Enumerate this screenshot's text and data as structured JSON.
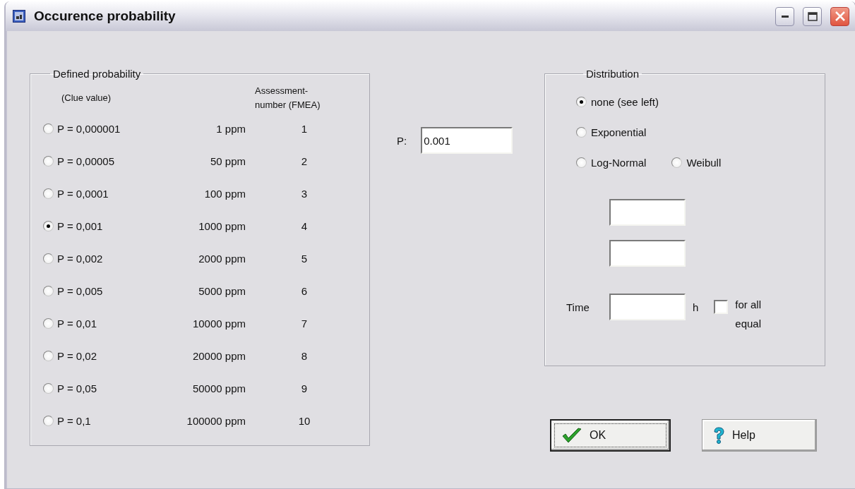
{
  "window": {
    "title": "Occurence probability"
  },
  "defined_probability": {
    "title": "Defined probability",
    "column_headers": [
      "(Clue value)",
      "Assessment-\nnumber (FMEA)"
    ],
    "options": [
      {
        "label": "P = 0,000001",
        "ppm": "1 ppm",
        "number": "1",
        "selected": false
      },
      {
        "label": "P = 0,00005",
        "ppm": "50 ppm",
        "number": "2",
        "selected": false
      },
      {
        "label": "P = 0,0001",
        "ppm": "100 ppm",
        "number": "3",
        "selected": false
      },
      {
        "label": "P = 0,001",
        "ppm": "1000 ppm",
        "number": "4",
        "selected": true
      },
      {
        "label": "P = 0,002",
        "ppm": "2000 ppm",
        "number": "5",
        "selected": false
      },
      {
        "label": "P = 0,005",
        "ppm": "5000 ppm",
        "number": "6",
        "selected": false
      },
      {
        "label": "P = 0,01",
        "ppm": "10000 ppm",
        "number": "7",
        "selected": false
      },
      {
        "label": "P = 0,02",
        "ppm": "20000 ppm",
        "number": "8",
        "selected": false
      },
      {
        "label": "P = 0,05",
        "ppm": "50000 ppm",
        "number": "9",
        "selected": false
      },
      {
        "label": "P = 0,1",
        "ppm": "100000 ppm",
        "number": "10",
        "selected": false
      }
    ]
  },
  "p_field": {
    "label": "P:",
    "value": "0.001"
  },
  "distribution": {
    "title": "Distribution",
    "options": [
      {
        "label": "none (see left)",
        "selected": true
      },
      {
        "label": "Exponential",
        "selected": false
      },
      {
        "label": "Log-Normal",
        "selected": false
      },
      {
        "label": "Weibull",
        "selected": false
      }
    ],
    "time_label": "Time",
    "time_unit": "h",
    "for_all_equal": {
      "label": "for all\nequal",
      "checked": false
    }
  },
  "buttons": [
    {
      "kind": "ok",
      "label": "OK",
      "focused": true
    },
    {
      "kind": "help",
      "label": "Help",
      "focused": false
    }
  ]
}
